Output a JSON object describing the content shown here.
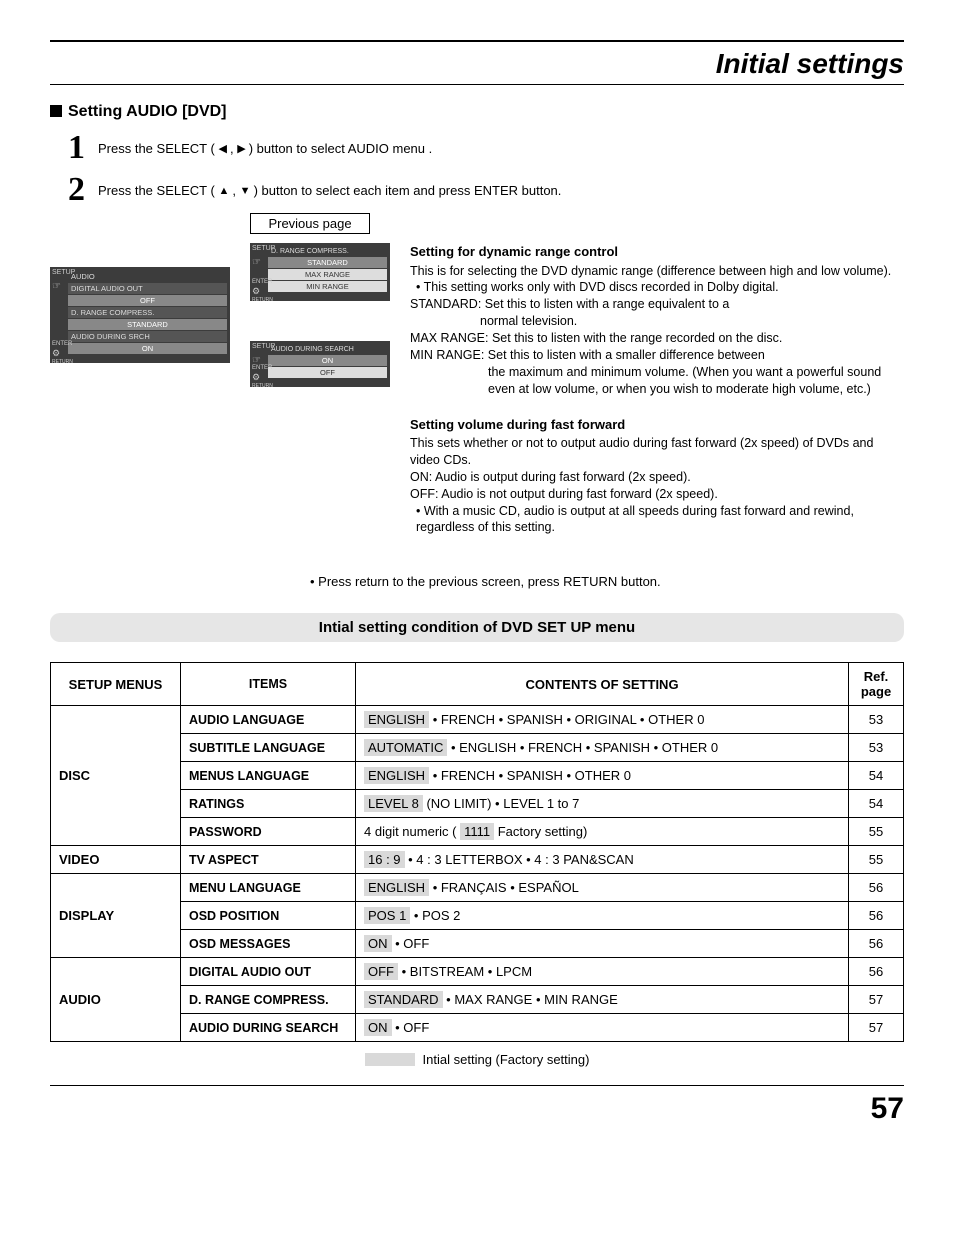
{
  "header": {
    "title": "Initial settings"
  },
  "section": {
    "heading": "Setting AUDIO [DVD]"
  },
  "steps": {
    "s1_a": "Press the SELECT (",
    "s1_b": ") button to select AUDIO menu .",
    "s2_a": "Press the SELECT (",
    "s2_b": ") button to select each item and press ENTER button."
  },
  "prev_page": "Previous page",
  "osd_large": {
    "setup": "SETUP",
    "cat": "AUDIO",
    "r1": "DIGITAL AUDIO OUT",
    "r1v": "OFF",
    "r2": "D. RANGE COMPRESS.",
    "r2v": "STANDARD",
    "r3": "AUDIO DURING SRCH",
    "r3v": "ON",
    "enter": "ENTER",
    "return": "RETURN"
  },
  "osd_a": {
    "setup": "SETUP",
    "title": "D. RANGE COMPRESS.",
    "o1": "STANDARD",
    "o2": "MAX RANGE",
    "o3": "MIN RANGE",
    "enter": "ENTER",
    "return": "RETURN"
  },
  "osd_b": {
    "setup": "SETUP",
    "title": "AUDIO DURING SEARCH",
    "o1": "ON",
    "o2": "OFF",
    "enter": "ENTER",
    "return": "RETURN"
  },
  "desc_a": {
    "title": "Setting for dynamic range control",
    "l1": "This is for selecting the DVD dynamic range (difference between high and low volume).",
    "l2": "• This setting works only with DVD discs recorded in Dolby digital.",
    "l3": "STANDARD: Set this to listen with a range equivalent to a",
    "l3b": "normal television.",
    "l4": "MAX RANGE: Set this to listen with the range recorded on the disc.",
    "l5": "MIN RANGE: Set this to listen with a smaller difference between",
    "l5b": "the maximum and minimum volume. (When you want a powerful sound even at low volume, or when you wish to moderate high volume, etc.)"
  },
  "desc_b": {
    "title": "Setting volume during fast forward",
    "l1": "This sets whether or not to output audio during fast forward (2x speed) of DVDs and video CDs.",
    "l2": "ON:   Audio is output during fast forward (2x speed).",
    "l3": "OFF: Audio is not output during fast forward (2x speed).",
    "l4": "• With a music CD, audio is output at all speeds during fast forward and rewind, regardless of this setting."
  },
  "note": "• Press return to the previous screen, press RETURN button.",
  "band": "Intial setting condition of DVD SET UP menu",
  "table": {
    "h1": "SETUP MENUS",
    "h2": "ITEMS",
    "h3": "CONTENTS OF SETTING",
    "h4": "Ref. page",
    "groups": [
      {
        "menu": "DISC",
        "rows": [
          {
            "item": "AUDIO LANGUAGE",
            "hl": "ENGLISH",
            "rest": " • FRENCH • SPANISH • ORIGINAL • OTHER 0",
            "ref": "53"
          },
          {
            "item": "SUBTITLE LANGUAGE",
            "hl": "AUTOMATIC",
            "rest": " • ENGLISH • FRENCH • SPANISH • OTHER 0",
            "ref": "53"
          },
          {
            "item": "MENUS LANGUAGE",
            "hl": "ENGLISH",
            "rest": "  •  FRENCH  •  SPANISH  •  OTHER 0",
            "ref": "54"
          },
          {
            "item": "RATINGS",
            "hl": "LEVEL 8",
            "rest": "  (NO LIMIT)   •   LEVEL 1 to 7",
            "ref": "54"
          },
          {
            "item": "PASSWORD",
            "pre": "4 digit numeric  ( ",
            "hl": "1111",
            "rest": "   Factory setting)",
            "ref": "55"
          }
        ]
      },
      {
        "menu": "VIDEO",
        "rows": [
          {
            "item": "TV ASPECT",
            "hl": "16 : 9",
            "rest": "     •   4 : 3 LETTERBOX   •   4 : 3 PAN&SCAN",
            "ref": "55"
          }
        ]
      },
      {
        "menu": "DISPLAY",
        "rows": [
          {
            "item": "MENU LANGUAGE",
            "hl": "ENGLISH",
            "rest": "    •   FRANÇAIS   •   ESPAÑOL",
            "ref": "56"
          },
          {
            "item": "OSD POSITION",
            "hl": "POS 1",
            "rest": "      •    POS 2",
            "ref": "56"
          },
          {
            "item": "OSD MESSAGES",
            "hl": "ON",
            "rest": "     •    OFF",
            "ref": "56"
          }
        ]
      },
      {
        "menu": "AUDIO",
        "rows": [
          {
            "item": "DIGITAL AUDIO OUT",
            "hl": "OFF",
            "rest": "     •    BITSTREAM    •    LPCM",
            "ref": "56"
          },
          {
            "item": "D. RANGE COMPRESS.",
            "hl": "STANDARD",
            "rest": "    •    MAX RANGE    •    MIN RANGE",
            "ref": "57"
          },
          {
            "item": "AUDIO DURING SEARCH",
            "hl": "ON",
            "rest": "     •    OFF",
            "ref": "57"
          }
        ]
      }
    ]
  },
  "legend": "Intial setting (Factory setting)",
  "pagenum": "57"
}
